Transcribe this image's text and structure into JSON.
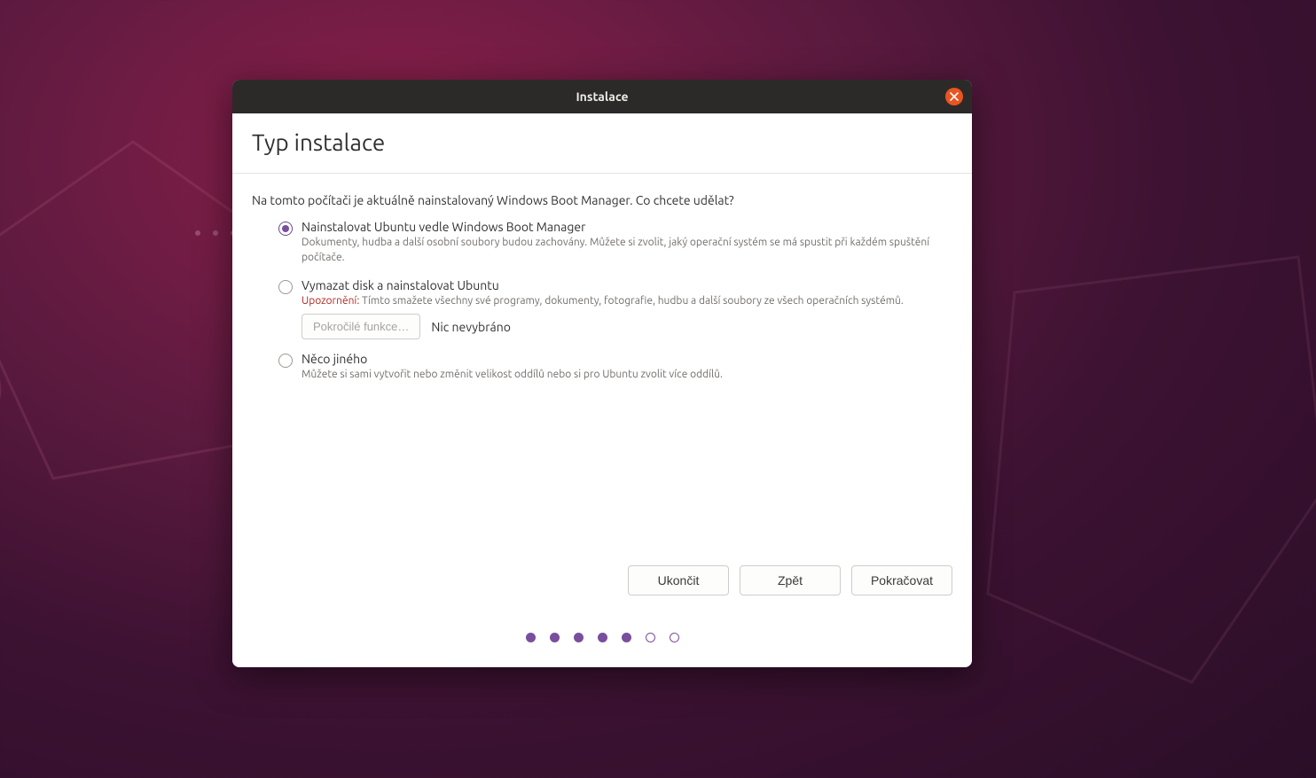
{
  "window": {
    "title": "Instalace"
  },
  "page": {
    "title": "Typ instalace",
    "intro": "Na tomto počítači je aktuálně nainstalovaný Windows Boot Manager. Co chcete udělat?"
  },
  "options": {
    "alongside": {
      "label": "Nainstalovat Ubuntu vedle Windows Boot Manager",
      "desc": "Dokumenty, hudba a další osobní soubory budou zachovány. Můžete si zvolit, jaký operační systém se má spustit při každém spuštění počítače.",
      "selected": true
    },
    "erase": {
      "label": "Vymazat disk a nainstalovat Ubuntu",
      "warn_prefix": "Upozornění:",
      "warn_text": " Tímto smažete všechny své programy, dokumenty, fotografie, hudbu a další soubory ze všech operačních systémů.",
      "advanced_button": "Pokročilé funkce…",
      "advanced_status": "Nic nevybráno",
      "selected": false
    },
    "other": {
      "label": "Něco jiného",
      "desc": "Můžete si sami vytvořit nebo změnit velikost oddílů nebo si pro Ubuntu zvolit více oddílů.",
      "selected": false
    }
  },
  "buttons": {
    "quit": "Ukončit",
    "back": "Zpět",
    "continue": "Pokračovat"
  },
  "pager": {
    "total": 7,
    "current": 5
  },
  "colors": {
    "accent": "#e95420",
    "radio": "#7b4d9d",
    "warning": "#b0291f"
  }
}
